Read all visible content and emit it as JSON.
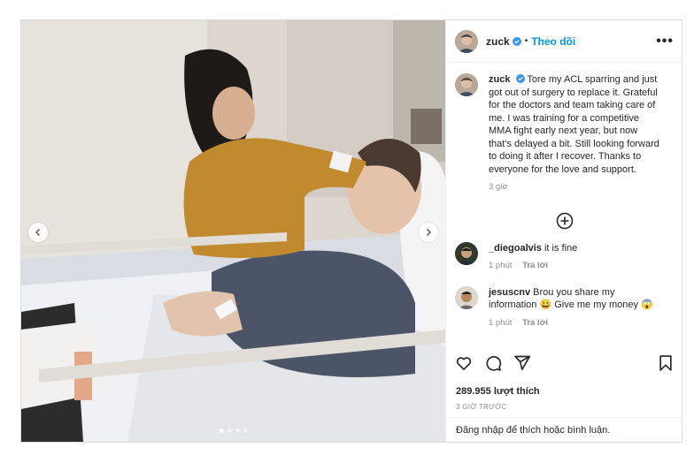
{
  "header": {
    "username": "zuck",
    "separator": "•",
    "follow_label": "Theo dõi",
    "more_label": "•••"
  },
  "caption": {
    "username": "zuck",
    "text": "Tore my ACL sparring and just got out of surgery to replace it. Grateful for the doctors and team taking care of me. I was training for a competitive MMA fight early next year, but now that's delayed a bit. Still looking forward to doing it after I recover. Thanks to everyone for the love and support.",
    "time": "3 giờ"
  },
  "comments": [
    {
      "username": "_diegoalvis",
      "text": "it is fine",
      "time": "1 phút",
      "reply": "Trả lời"
    },
    {
      "username": "jesuscnv",
      "text": "Brou you share my information 😀 Give me my money 😱",
      "time": "1 phút",
      "reply": "Trả lời"
    }
  ],
  "post": {
    "likes": "289.955 lượt thích",
    "ago": "3 GIỜ TRƯỚC",
    "login_prompt": "Đăng nhập để thích hoặc bình luận."
  },
  "carousel": {
    "slides": 4,
    "active_slide": 1
  },
  "icons": {
    "like": "heart-icon",
    "comment": "comment-icon",
    "share": "send-icon",
    "save": "bookmark-icon",
    "verified": "verified-badge-icon",
    "add": "plus-circle-icon",
    "prev": "chevron-left-icon",
    "next": "chevron-right-icon"
  },
  "colors": {
    "link": "#0095f6",
    "verified": "#3897f0",
    "muted": "#8e8e8e",
    "border": "#dbdbdb"
  }
}
